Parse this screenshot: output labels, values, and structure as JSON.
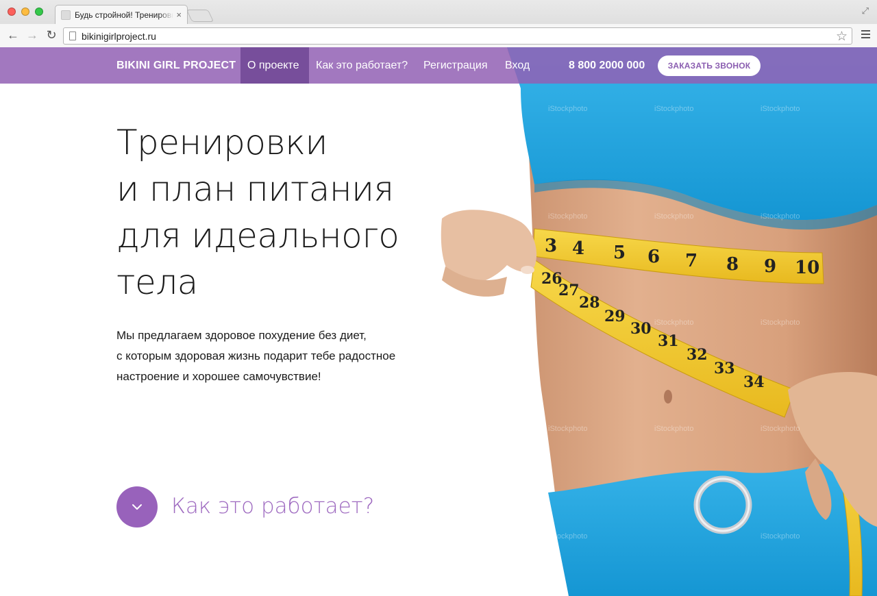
{
  "browser": {
    "tab_title": "Будь стройной! Тренировки",
    "tab_close": "×",
    "url": "bikinigirlproject.ru",
    "icons": [
      "back-arrow-icon",
      "forward-arrow-icon",
      "reload-icon",
      "page-icon",
      "star-icon",
      "menu-icon",
      "fullscreen-icon"
    ],
    "back": "←",
    "forward": "→",
    "reload": "↻",
    "star": "☆",
    "fullscreen": "⤢"
  },
  "site": {
    "logo": "BIKINI GIRL PROJECT",
    "nav": [
      {
        "label": "О проекте",
        "active": true
      },
      {
        "label": "Как это работает?",
        "active": false
      },
      {
        "label": "Регистрация",
        "active": false
      },
      {
        "label": "Вход",
        "active": false
      }
    ],
    "phone": "8 800 2000 000",
    "call_button": "ЗАКАЗАТЬ ЗВОНОК",
    "accent_color": "#9862bb"
  },
  "hero": {
    "headline": [
      "Тренировки",
      "и план питания",
      "для идеального",
      "тела"
    ],
    "lead": [
      "Мы предлагаем здоровое похудение без диет,",
      "с которым здоровая жизнь подарит тебе радостное",
      "настроение и хорошее самочувствие!"
    ],
    "how_link": "Как это работает?",
    "how_icon": "chevron-down-icon",
    "watermark": "iStockphoto",
    "tape_numbers_top": [
      "3",
      "4",
      "5",
      "6",
      "7",
      "8",
      "9",
      "10"
    ],
    "tape_numbers_bottom": [
      "26",
      "27",
      "28",
      "29",
      "30",
      "31",
      "32",
      "33",
      "34"
    ]
  }
}
